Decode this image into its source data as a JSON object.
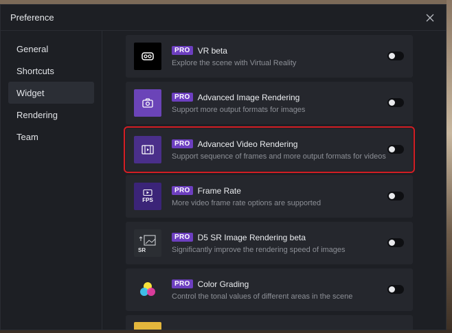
{
  "window": {
    "title": "Preference"
  },
  "sidebar": {
    "items": [
      {
        "label": "General",
        "active": false
      },
      {
        "label": "Shortcuts",
        "active": false
      },
      {
        "label": "Widget",
        "active": true
      },
      {
        "label": "Rendering",
        "active": false
      },
      {
        "label": "Team",
        "active": false
      }
    ]
  },
  "widgets": [
    {
      "badge": "PRO",
      "name": "VR beta",
      "desc": "Explore the scene with Virtual Reality",
      "icon": "vr-headset-icon",
      "icon_bg": "#000000",
      "enabled": false
    },
    {
      "badge": "PRO",
      "name": "Advanced Image Rendering",
      "desc": "Support more output formats for images",
      "icon": "camera-icon",
      "icon_bg": "#6b44b8",
      "enabled": false
    },
    {
      "badge": "PRO",
      "name": "Advanced Video Rendering",
      "desc": "Support sequence of frames and more output formats for videos",
      "icon": "film-icon",
      "icon_bg": "#4a2f8a",
      "enabled": false
    },
    {
      "badge": "PRO",
      "name": "Frame Rate",
      "desc": "More video frame rate options are supported",
      "icon_text": "FPS",
      "icon": "fps-icon",
      "icon_bg": "#3b2478",
      "enabled": false
    },
    {
      "badge": "PRO",
      "name": "D5 SR Image Rendering beta",
      "desc": "Significantly improve the rendering speed of images",
      "icon_text": "SR",
      "icon": "sr-image-icon",
      "icon_bg": "#2b2e33",
      "enabled": false
    },
    {
      "badge": "PRO",
      "name": "Color Grading",
      "desc": "Control the tonal values of different areas in the scene",
      "icon": "color-grading-icon",
      "icon_bg": "#25272d",
      "enabled": false
    }
  ],
  "colors": {
    "accent": "#6d3fc0",
    "highlight": "#d41e24"
  }
}
